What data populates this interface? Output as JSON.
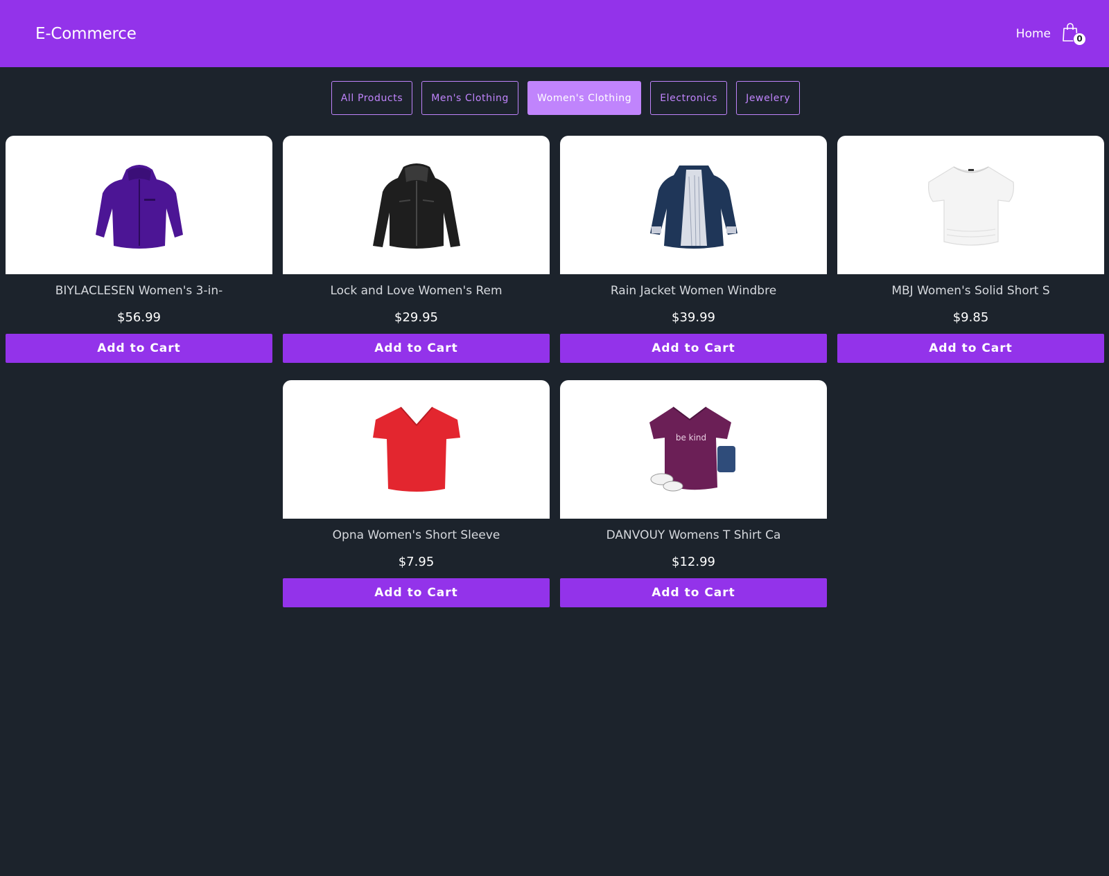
{
  "header": {
    "brand": "E-Commerce",
    "home_link": "Home",
    "cart_count": "0",
    "cart_icon": "shopping-bag-icon"
  },
  "filters": {
    "active": "Women's Clothing",
    "items": [
      {
        "label": "All Products"
      },
      {
        "label": "Men's Clothing"
      },
      {
        "label": "Women's Clothing"
      },
      {
        "label": "Electronics"
      },
      {
        "label": "Jewelery"
      }
    ]
  },
  "products": [
    {
      "title": "BIYLACLESEN Women's 3-in-",
      "price": "$56.99",
      "button": "Add to Cart",
      "image": "purple-jacket"
    },
    {
      "title": "Lock and Love Women's Rem",
      "price": "$29.95",
      "button": "Add to Cart",
      "image": "black-leather-jacket"
    },
    {
      "title": "Rain Jacket Women Windbre",
      "price": "$39.99",
      "button": "Add to Cart",
      "image": "navy-rain-jacket"
    },
    {
      "title": "MBJ Women's Solid Short S",
      "price": "$9.85",
      "button": "Add to Cart",
      "image": "white-tshirt"
    },
    {
      "title": "Opna Women's Short Sleeve",
      "price": "$7.95",
      "button": "Add to Cart",
      "image": "red-tshirt"
    },
    {
      "title": "DANVOUY Womens T Shirt Ca",
      "price": "$12.99",
      "button": "Add to Cart",
      "image": "be-kind-tshirt"
    }
  ],
  "tshirt_print": "be kind",
  "colors": {
    "brand_purple": "#9333ea",
    "filter_accent": "#c084fc",
    "background": "#1c232c"
  }
}
